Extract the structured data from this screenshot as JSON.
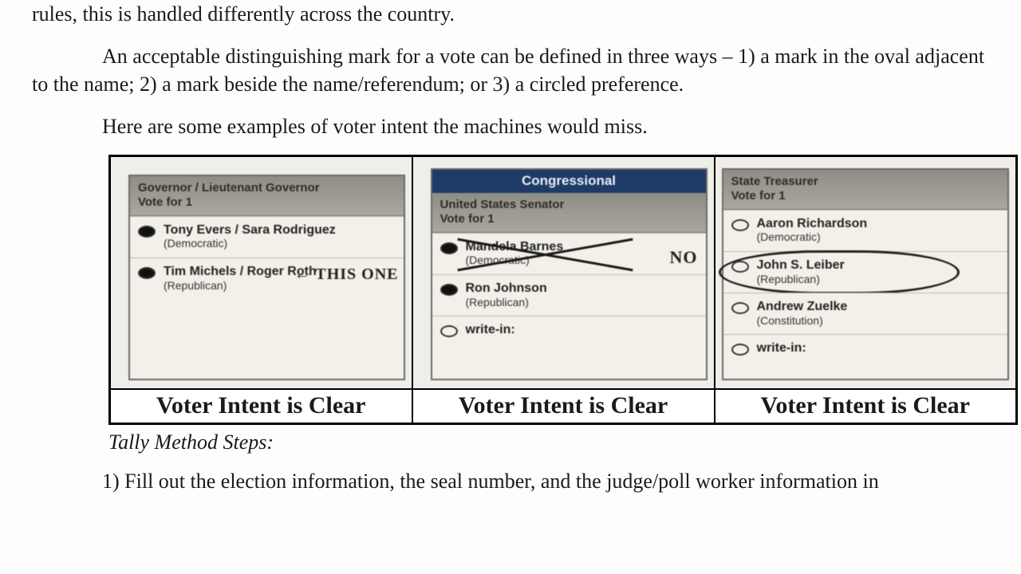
{
  "text": {
    "line_top": "rules, this is handled differently across the country.",
    "para_marks": "An acceptable distinguishing mark for a vote can be defined in three ways – 1) a mark in the oval adjacent to the name; 2) a mark beside the name/referendum; or 3) a circled preference.",
    "para_examples": "Here are some examples of voter intent the machines would miss.",
    "subhead": "Tally Method Steps:",
    "step1": "1) Fill out the election information, the seal number, and the judge/poll worker information in"
  },
  "captions": {
    "c1": "Voter Intent is Clear",
    "c2": "Voter Intent is Clear",
    "c3": "Voter Intent is Clear"
  },
  "ballots": {
    "b1": {
      "header": "Governor / Lieutenant Governor\nVote for 1",
      "rows": [
        {
          "name": "Tony Evers / Sara Rodriguez",
          "party": "(Democratic)",
          "filled": true
        },
        {
          "name": "Tim Michels / Roger Roth",
          "party": "(Republican)",
          "filled": true
        }
      ],
      "annotation": "← THIS ONE"
    },
    "b2": {
      "titlebar": "Congressional",
      "header": "United States Senator\nVote for 1",
      "rows": [
        {
          "name": "Mandela Barnes",
          "party": "(Democratic)",
          "filled": true
        },
        {
          "name": "Ron Johnson",
          "party": "(Republican)",
          "filled": true
        },
        {
          "name": "write-in:",
          "party": "",
          "filled": false
        }
      ],
      "annotation": "NO"
    },
    "b3": {
      "header": "State Treasurer\nVote for 1",
      "rows": [
        {
          "name": "Aaron Richardson",
          "party": "(Democratic)",
          "filled": false
        },
        {
          "name": "John S. Leiber",
          "party": "(Republican)",
          "filled": false
        },
        {
          "name": "Andrew Zuelke",
          "party": "(Constitution)",
          "filled": false
        },
        {
          "name": "write-in:",
          "party": "",
          "filled": false
        }
      ]
    }
  }
}
